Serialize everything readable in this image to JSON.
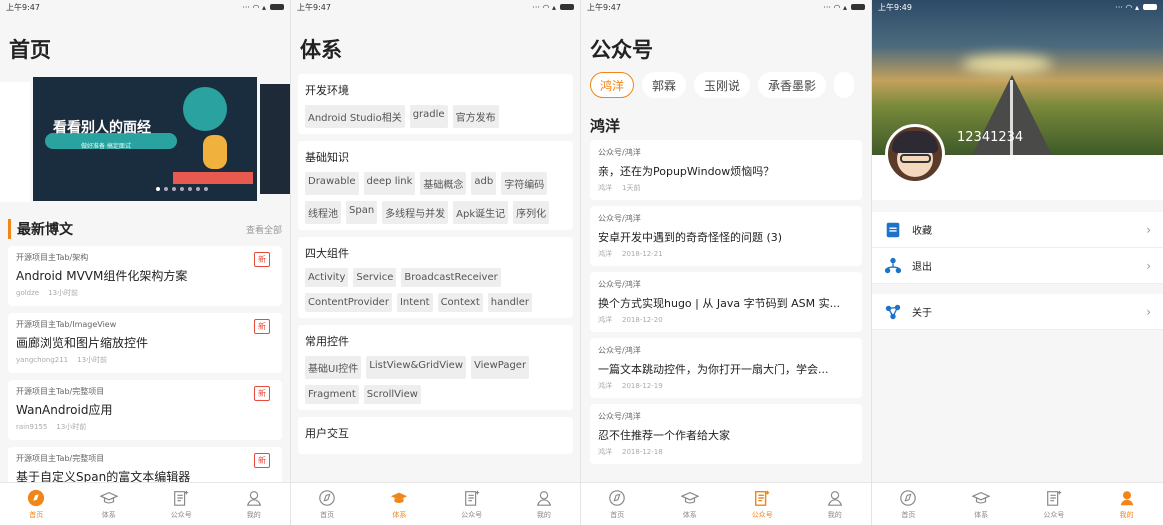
{
  "status": {
    "time1": "上午9:47",
    "time2": "上午9:47",
    "time3": "上午9:47",
    "time4": "上午9:49",
    "icons": "... "
  },
  "tabs": [
    {
      "label": "首页",
      "icon": "home-icon"
    },
    {
      "label": "体系",
      "icon": "graduation-cap-icon"
    },
    {
      "label": "公众号",
      "icon": "article-icon"
    },
    {
      "label": "我的",
      "icon": "person-icon"
    }
  ],
  "home": {
    "title": "首页",
    "banner": {
      "title": "看看别人的面经",
      "subtitle": "做好准备 搞定面试"
    },
    "latest_title": "最新博文",
    "view_all": "查看全部",
    "new_badge": "新",
    "posts": [
      {
        "category": "开源项目主Tab/架构",
        "title": "Android MVVM组件化架构方案",
        "author": "goldze",
        "time": "13小时前"
      },
      {
        "category": "开源项目主Tab/ImageView",
        "title": "画廊浏览和图片缩放控件",
        "author": "yangchong211",
        "time": "13小时前"
      },
      {
        "category": "开源项目主Tab/完整项目",
        "title": "WanAndroid应用",
        "author": "rain9155",
        "time": "13小时前"
      },
      {
        "category": "开源项目主Tab/完整项目",
        "title": "基于自定义Span的富文本编辑器",
        "author": "",
        "time": ""
      }
    ]
  },
  "tree": {
    "title": "体系",
    "groups": [
      {
        "name": "开发环境",
        "items": [
          "Android Studio相关",
          "gradle",
          "官方发布"
        ]
      },
      {
        "name": "基础知识",
        "items": [
          "Drawable",
          "deep link",
          "基础概念",
          "adb",
          "字符编码",
          "线程池",
          "Span",
          "多线程与并发",
          "Apk诞生记",
          "序列化"
        ]
      },
      {
        "name": "四大组件",
        "items": [
          "Activity",
          "Service",
          "BroadcastReceiver",
          "ContentProvider",
          "Intent",
          "Context",
          "handler"
        ]
      },
      {
        "name": "常用控件",
        "items": [
          "基础UI控件",
          "ListView&GridView",
          "ViewPager",
          "Fragment",
          "ScrollView"
        ]
      },
      {
        "name": "用户交互",
        "items": []
      }
    ]
  },
  "wx": {
    "title": "公众号",
    "chips": [
      "鸿洋",
      "郭霖",
      "玉刚说",
      "承香墨影"
    ],
    "selected_name": "鸿洋",
    "articles": [
      {
        "category": "公众号/鸿洋",
        "title": "亲，还在为PopupWindow烦恼吗？",
        "author": "鸿洋",
        "time": "1天前"
      },
      {
        "category": "公众号/鸿洋",
        "title": "安卓开发中遇到的奇奇怪怪的问题 (3)",
        "author": "鸿洋",
        "time": "2018-12-21"
      },
      {
        "category": "公众号/鸿洋",
        "title": "换个方式实现hugo | 从 Java 字节码到 ASM 实...",
        "author": "鸿洋",
        "time": "2018-12-20"
      },
      {
        "category": "公众号/鸿洋",
        "title": "一篇文本跳动控件，为你打开一扇大门，学会...",
        "author": "鸿洋",
        "time": "2018-12-19"
      },
      {
        "category": "公众号/鸿洋",
        "title": "忍不住推荐一个作者给大家",
        "author": "鸿洋",
        "time": "2018-12-18"
      }
    ]
  },
  "mine": {
    "username": "12341234",
    "menu": [
      {
        "label": "收藏",
        "icon": "collect-icon"
      },
      {
        "label": "退出",
        "icon": "logout-icon"
      }
    ],
    "menu2": [
      {
        "label": "关于",
        "icon": "about-icon"
      }
    ],
    "chevron": "›"
  },
  "colors": {
    "accent": "#f08519",
    "new_badge": "#e84a3c",
    "icon_blue": "#1d73c9"
  }
}
